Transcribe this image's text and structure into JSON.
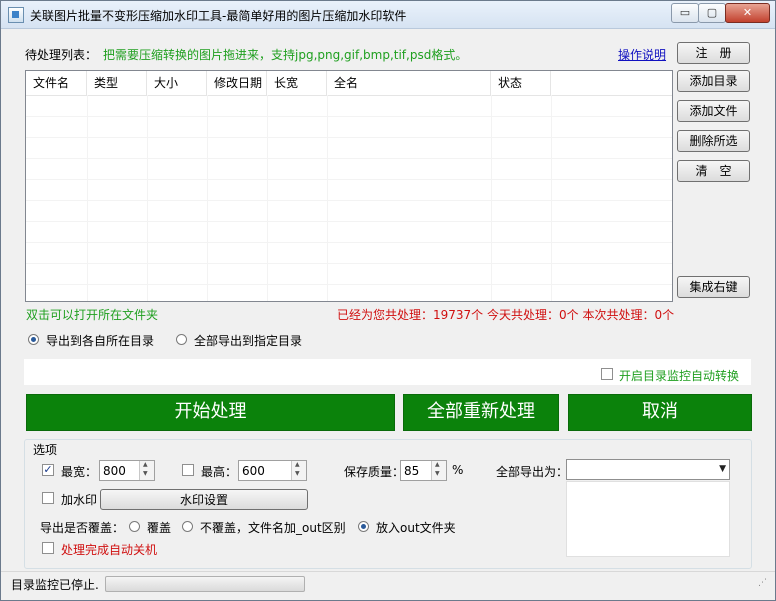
{
  "window": {
    "title": "关联图片批量不变形压缩加水印工具-最简单好用的图片压缩加水印软件",
    "minimize": "▭",
    "restore": "▢",
    "close": "✕"
  },
  "header": {
    "list_label": "待处理列表：",
    "hint": "把需要压缩转换的图片拖进来，支持jpg,png,gif,bmp,tif,psd格式。",
    "help_link": "操作说明"
  },
  "side_buttons": {
    "register": "注　册",
    "add_dir": "添加目录",
    "add_file": "添加文件",
    "delete_selected": "删除所选",
    "clear": "清　空",
    "integrate_menu": "集成右键"
  },
  "table": {
    "columns": [
      "文件名",
      "类型",
      "大小",
      "修改日期",
      "长宽",
      "全名",
      "状态"
    ],
    "rows": []
  },
  "info": {
    "dblclick_hint": "双击可以打开所在文件夹",
    "stats": "已经为您共处理：19737个 今天共处理：0个 本次共处理：0个"
  },
  "export_mode": {
    "options": [
      "导出到各自所在目录",
      "全部导出到指定目录"
    ],
    "selected": 0
  },
  "monitor": {
    "label": "开启目录监控自动转换",
    "checked": false
  },
  "actions": {
    "start": "开始处理",
    "reprocess": "全部重新处理",
    "cancel": "取消"
  },
  "options": {
    "group_title": "选项",
    "max_width_label": "最宽：",
    "max_width_checked": true,
    "max_width": "800",
    "max_height_label": "最高：",
    "max_height_checked": false,
    "max_height": "600",
    "quality_label": "保存质量：",
    "quality": "85",
    "quality_unit": "%",
    "export_all_label": "全部导出为：",
    "export_all_value": "",
    "watermark_label": "加水印",
    "watermark_checked": false,
    "watermark_button": "水印设置",
    "overwrite_label": "导出是否覆盖：",
    "overwrite_options": [
      "覆盖",
      "不覆盖，文件名加_out区别",
      "放入out文件夹"
    ],
    "overwrite_selected": 2,
    "shutdown_label": "处理完成自动关机",
    "shutdown_checked": false
  },
  "status": {
    "text": "目录监控已停止.",
    "progress": 0
  },
  "colors": {
    "accent_green": "#0b820b",
    "hint_green": "#1f9f1f",
    "stats_red": "#d01010"
  }
}
